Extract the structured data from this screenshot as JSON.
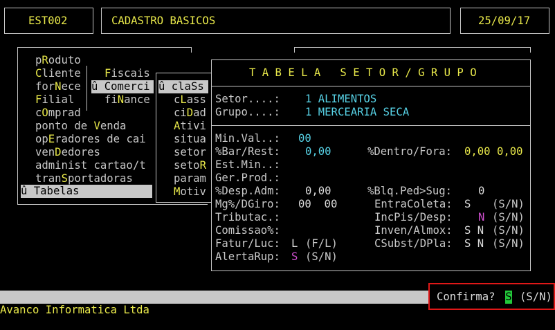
{
  "header": {
    "program_code": "EST002",
    "screen_title": "CADASTRO BASICOS",
    "date": "25/09/17"
  },
  "main_menu": {
    "items": [
      {
        "pre": "p",
        "key": "R",
        "post": "oduto"
      },
      {
        "pre": "",
        "key": "C",
        "post": "liente"
      },
      {
        "pre": "for",
        "key": "N",
        "post": "ece"
      },
      {
        "pre": "",
        "key": "F",
        "post": "ilial"
      },
      {
        "pre": "c",
        "key": "O",
        "post": "mprad"
      },
      {
        "pre": "ponto de ",
        "key": "V",
        "post": "enda"
      },
      {
        "pre": "op",
        "key": "E",
        "post": "radores de cai"
      },
      {
        "pre": "ven",
        "key": "D",
        "post": "edores"
      },
      {
        "pre": "administ cartao/t",
        "key": "",
        "post": ""
      },
      {
        "pre": "tran",
        "key": "S",
        "post": "portadoras"
      }
    ],
    "selected": "û Tabelas"
  },
  "submenu_1": {
    "items": [
      {
        "pre": "",
        "key": "F",
        "post": "iscais"
      },
      {
        "pre": "û Comerci",
        "key": "",
        "post": ""
      },
      {
        "pre": "fi",
        "key": "N",
        "post": "ance"
      }
    ]
  },
  "submenu_2": {
    "selected": "û claSs",
    "items": [
      {
        "pre": "c",
        "key": "L",
        "post": "ass"
      },
      {
        "pre": "ci",
        "key": "D",
        "post": "ad"
      },
      {
        "pre": "",
        "key": "A",
        "post": "tivi"
      },
      {
        "pre": "situa",
        "key": "",
        "post": ""
      },
      {
        "pre": "setor",
        "key": "",
        "post": ""
      },
      {
        "pre": "seto",
        "key": "R",
        "post": ""
      },
      {
        "pre": "param",
        "key": "",
        "post": ""
      },
      {
        "pre": "",
        "key": "M",
        "post": "otiv"
      }
    ]
  },
  "dialog": {
    "title": "T A B E L A   S E T O R / G R U P O",
    "setor_label": "Setor....:",
    "setor_value": "1 ALIMENTOS",
    "grupo_label": "Grupo....:",
    "grupo_value": "1 MERCEARIA SECA",
    "fields": {
      "min_val_label": "Min.Val..:",
      "min_val": "00",
      "bar_rest_label": "%Bar/Rest:",
      "bar_rest": "0,00",
      "dentro_fora_label": "%Dentro/Fora:",
      "dentro_fora": "0,00 0,00",
      "est_min_label": "Est.Min..:",
      "ger_prod_label": "Ger.Prod.:",
      "desp_adm_label": "%Desp.Adm:",
      "desp_adm": "0,00",
      "blq_ped_label": "%Blq.Ped>Sug:",
      "blq_ped": "0",
      "mg_dgiro_label": "Mg%/DGiro:",
      "mg_dgiro": "00  00",
      "entra_coleta_label": "EntraColeta:",
      "entra_coleta": "S",
      "entra_coleta_hint": "(S/N)",
      "tributac_label": "Tributac.:",
      "inc_pis_label": "IncPis/Desp:",
      "inc_pis": "N",
      "inc_pis_hint": "(S/N)",
      "comissao_label": "Comissao%:",
      "inven_label": "Inven/Almox:",
      "inven": "S N",
      "inven_hint": "(S/N)",
      "fatur_label": "Fatur/Luc:",
      "fatur": "L",
      "fatur_hint": "(F/L)",
      "csubst_label": "CSubst/DPla:",
      "csubst": "S N",
      "csubst_hint": "(S/N)",
      "alerta_label": "AlertaRup:",
      "alerta": "S",
      "alerta_hint": "(S/N)"
    }
  },
  "status_bar": {
    "prompt": "Confirma?",
    "answer": "S",
    "hint": "(S/N)"
  },
  "footer": {
    "company": "Avanco Informatica Ltda"
  },
  "colors": {
    "yellow": "#e8e84a",
    "cyan": "#57d2e6",
    "magenta": "#d050d0",
    "green": "#22c93a",
    "red_outline": "#e01818"
  }
}
